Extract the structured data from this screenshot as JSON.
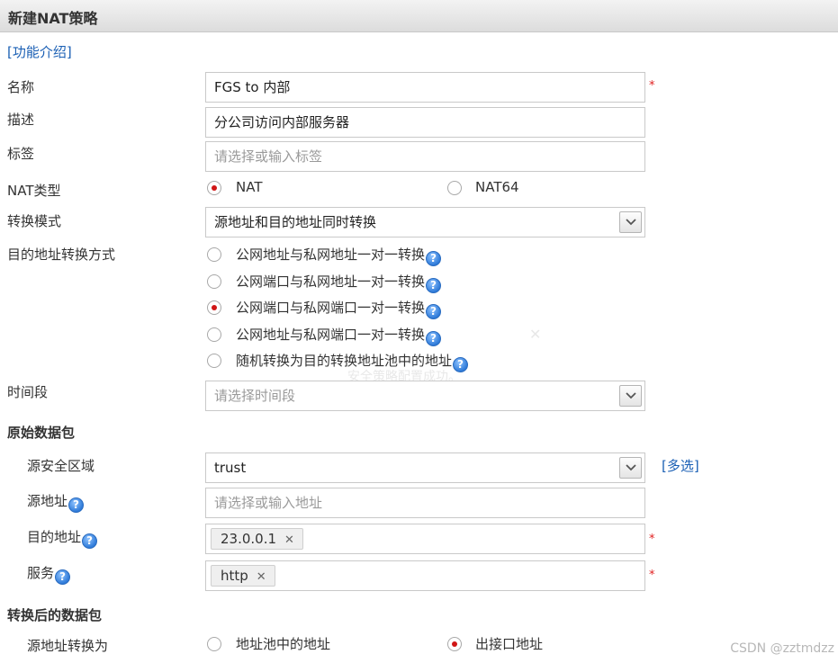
{
  "header": {
    "title": "新建NAT策略"
  },
  "intro_link": "[功能介绍]",
  "form": {
    "name": {
      "label": "名称",
      "value": "FGS to 内部",
      "required": "*"
    },
    "description": {
      "label": "描述",
      "value": "分公司访问内部服务器"
    },
    "tags": {
      "label": "标签",
      "placeholder": "请选择或输入标签"
    },
    "nat_type": {
      "label": "NAT类型",
      "options": [
        "NAT",
        "NAT64"
      ],
      "selected": "NAT"
    },
    "convert_mode": {
      "label": "转换模式",
      "value": "源地址和目的地址同时转换"
    },
    "dest_method": {
      "label": "目的地址转换方式",
      "options": [
        "公网地址与私网地址一对一转换",
        "公网端口与私网地址一对一转换",
        "公网端口与私网端口一对一转换",
        "公网地址与私网端口一对一转换",
        "随机转换为目的转换地址池中的地址"
      ],
      "selected": "公网端口与私网端口一对一转换"
    },
    "time_range": {
      "label": "时间段",
      "placeholder": "请选择时间段"
    }
  },
  "original_packet": {
    "title": "原始数据包",
    "src_zone": {
      "label": "源安全区域",
      "value": "trust",
      "multi_link": "[多选]"
    },
    "src_addr": {
      "label": "源地址",
      "placeholder": "请选择或输入地址"
    },
    "dst_addr": {
      "label": "目的地址",
      "tag": "23.0.0.1",
      "required": "*"
    },
    "service": {
      "label": "服务",
      "tag": "http",
      "required": "*"
    }
  },
  "converted_packet": {
    "title": "转换后的数据包",
    "src_convert": {
      "label": "源地址转换为",
      "options": [
        "地址池中的地址",
        "出接口地址"
      ],
      "selected": "出接口地址"
    }
  },
  "ghost_text": "安全策略配置成功。",
  "help_glyph": "?",
  "remove_glyph": "✕",
  "watermark": "CSDN @zztmdzz",
  "colors": {
    "required": "#e02020",
    "link": "#1a5fb4",
    "radio_selected": "#d01515"
  }
}
